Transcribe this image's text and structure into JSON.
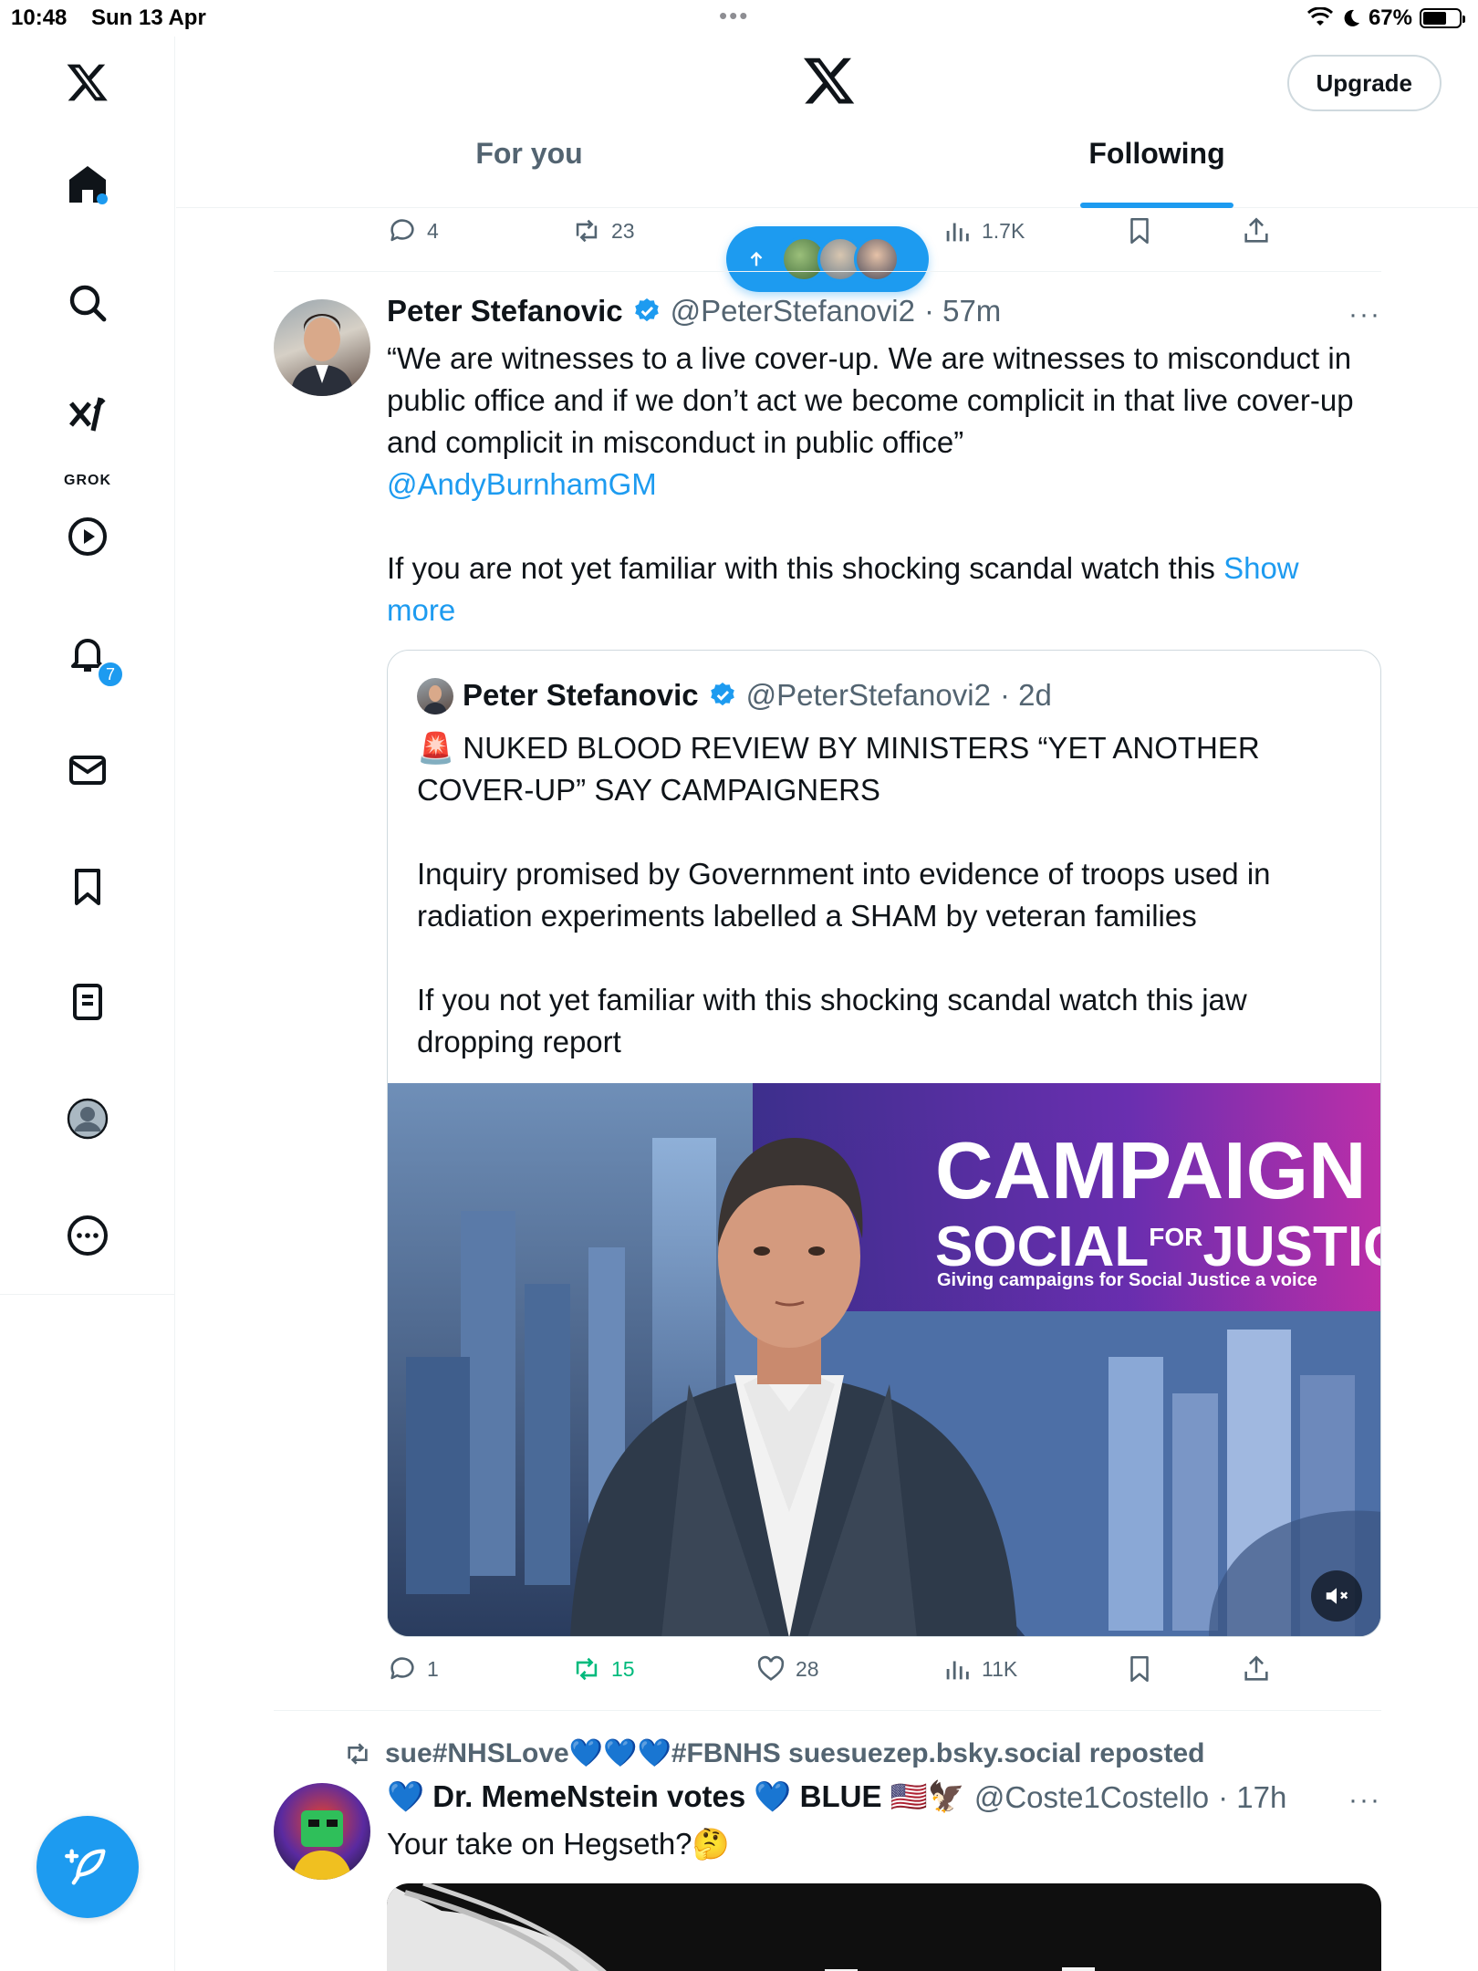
{
  "status_bar": {
    "time": "10:48",
    "date": "Sun 13 Apr",
    "battery": "67%",
    "battery_level": 0.67
  },
  "rail": {
    "grok_label": "GROK",
    "notifications_badge": "7"
  },
  "header": {
    "upgrade_label": "Upgrade",
    "tabs": [
      {
        "label": "For you",
        "active": false
      },
      {
        "label": "Following",
        "active": true
      }
    ]
  },
  "prev_tweet_stats": {
    "replies": "4",
    "reposts": "23",
    "views": "1.7K"
  },
  "tweet": {
    "name": "Peter Stefanovic",
    "handle": "@PeterStefanovi2",
    "time": "· 57m",
    "more": "···",
    "text_1": "“We are witnesses to a live cover-up. We are witnesses to misconduct in public office and if we don’t act we become complicit in that live cover-up and complicit in misconduct in public office”",
    "mention": "@AndyBurnhamGM",
    "text_2": "If you are not yet familiar with this shocking scandal watch this ",
    "show_more": "Show more",
    "stats": {
      "replies": "1",
      "reposts": "15",
      "likes": "28",
      "views": "11K"
    }
  },
  "quote": {
    "name": "Peter Stefanovic",
    "handle": "@PeterStefanovi2",
    "time": "· 2d",
    "siren": "🚨",
    "headline": "NUKED BLOOD REVIEW BY MINISTERS “YET ANOTHER COVER-UP” SAY CAMPAIGNERS",
    "para_1": "Inquiry promised by Government into evidence of troops used in radiation experiments labelled a SHAM by veteran families",
    "para_2": "If you not yet familiar with this shocking scandal watch this jaw dropping report",
    "video": {
      "title_1": "CAMPAIGN",
      "title_2a": "SOCIAL",
      "title_2b": "FOR",
      "title_2c": "JUSTICE",
      "tagline": "Giving campaigns for Social Justice a voice"
    }
  },
  "next_tweet": {
    "repost_label": "sue#NHSLove💙💙💙#FBNHS suesuezep.bsky.social reposted",
    "name": "💙 Dr. MemeNstein votes 💙 BLUE 🇺🇸🦅",
    "handle": "@Coste1Costello",
    "time": "· 17h",
    "more": "···",
    "text": "Your take on Hegseth?🤔"
  },
  "colors": {
    "accent": "#1d9bf0",
    "text": "#0f1419",
    "muted": "#536471",
    "repost_green": "#00ba7c"
  }
}
